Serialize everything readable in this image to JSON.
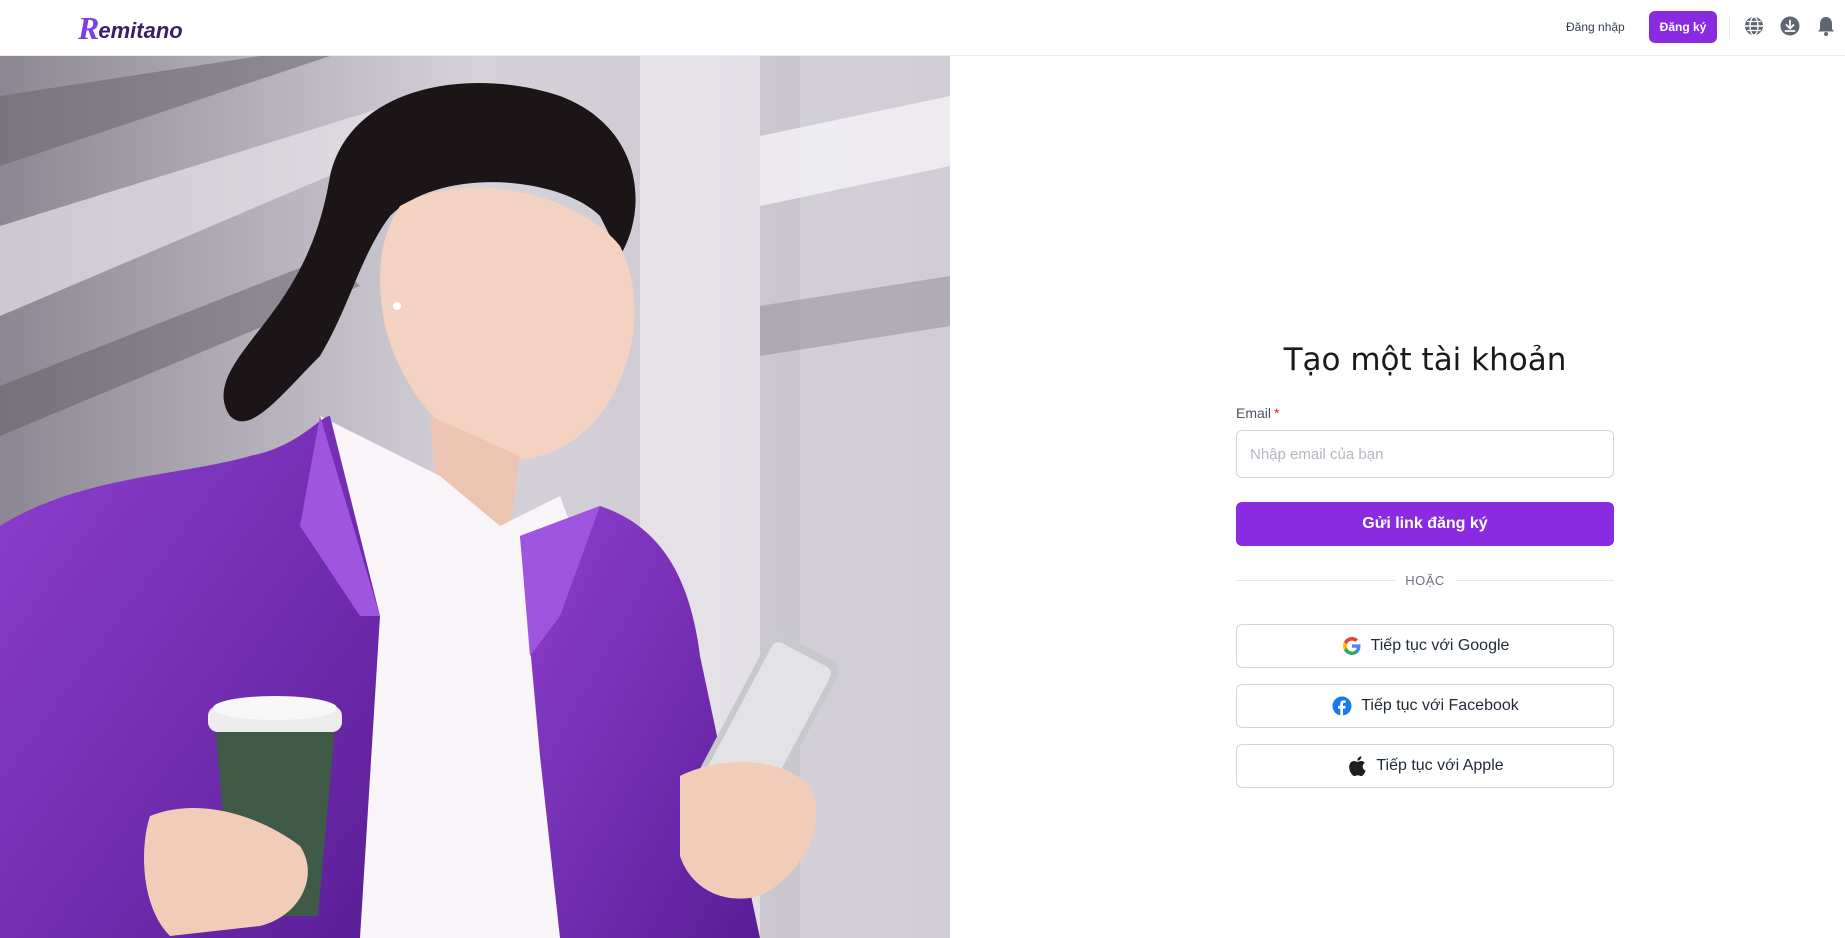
{
  "header": {
    "logo_first_letter": "R",
    "logo_rest": "emitano",
    "login_label": "Đăng nhập",
    "signup_label": "Đăng ký",
    "icons": [
      "globe-icon",
      "download-icon",
      "bell-icon"
    ]
  },
  "colors": {
    "brand": "#8a2be2",
    "logo_dark": "#3b1f6b",
    "required": "#dc2626"
  },
  "form": {
    "title": "Tạo một tài khoản",
    "email_label": "Email",
    "required_mark": "*",
    "email_placeholder": "Nhập email của bạn",
    "email_value": "",
    "submit_label": "Gửi link đăng ký",
    "divider_text": "HOẶC",
    "google_label": "Tiếp tục với Google",
    "facebook_label": "Tiếp tục với Facebook",
    "apple_label": "Tiếp tục với Apple"
  }
}
